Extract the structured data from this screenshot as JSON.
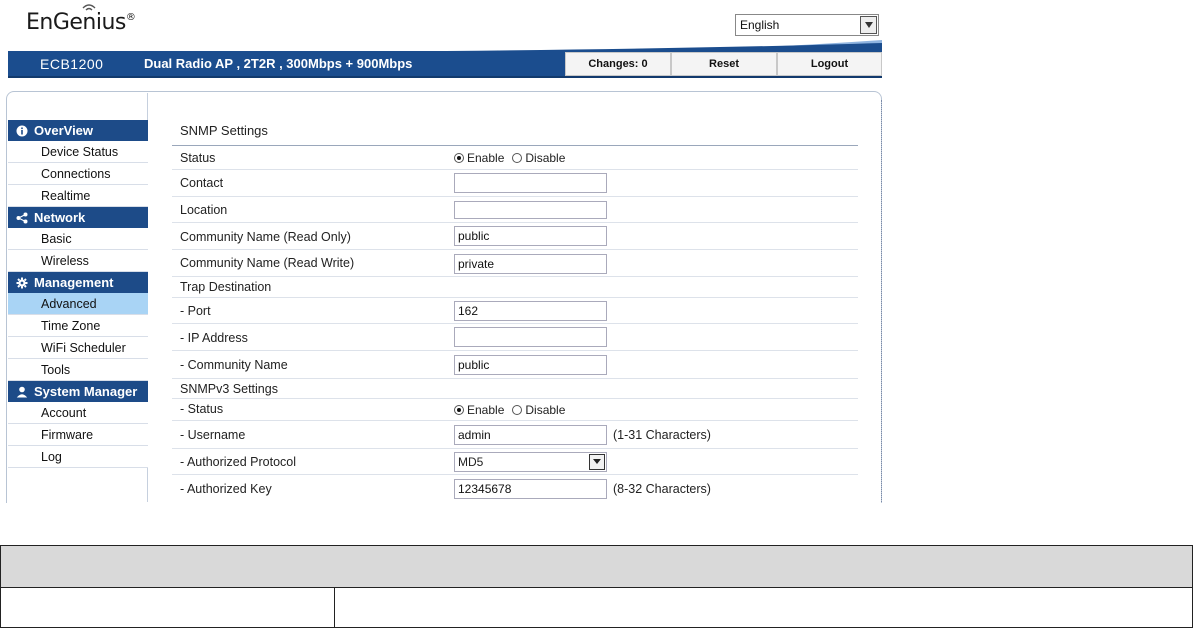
{
  "brand": {
    "name": "EnGenius",
    "reg": "®"
  },
  "language": {
    "selected": "English"
  },
  "header": {
    "model": "ECB1200",
    "description": "Dual Radio AP , 2T2R , 300Mbps + 900Mbps",
    "changes_label": "Changes: 0",
    "reset_label": "Reset",
    "logout_label": "Logout"
  },
  "sidebar": {
    "overview": {
      "title": "OverView",
      "items": [
        "Device Status",
        "Connections",
        "Realtime"
      ]
    },
    "network": {
      "title": "Network",
      "items": [
        "Basic",
        "Wireless"
      ]
    },
    "management": {
      "title": "Management",
      "items": [
        "Advanced",
        "Time Zone",
        "WiFi Scheduler",
        "Tools"
      ],
      "active": "Advanced"
    },
    "system": {
      "title": "System Manager",
      "items": [
        "Account",
        "Firmware",
        "Log"
      ]
    }
  },
  "form": {
    "title": "SNMP Settings",
    "status_label": "Status",
    "enable_label": "Enable",
    "disable_label": "Disable",
    "contact_label": "Contact",
    "contact_value": "",
    "location_label": "Location",
    "location_value": "",
    "community_ro_label": "Community Name (Read Only)",
    "community_ro_value": "public",
    "community_rw_label": "Community Name (Read Write)",
    "community_rw_value": "private",
    "trap_label": "Trap Destination",
    "port_label": "- Port",
    "port_value": "162",
    "ip_label": "- IP Address",
    "ip_value": "",
    "trap_community_label": "- Community Name",
    "trap_community_value": "public",
    "snmpv3_label": "SNMPv3 Settings",
    "v3_status_label": "- Status",
    "username_label": "- Username",
    "username_value": "admin",
    "username_hint": "(1-31 Characters)",
    "auth_protocol_label": "- Authorized Protocol",
    "auth_protocol_value": "MD5",
    "auth_key_label": "- Authorized Key",
    "auth_key_value": "12345678",
    "auth_key_hint": "(8-32 Characters)"
  },
  "colors": {
    "brand_blue": "#1b4d8e",
    "active_item": "#a9d4f5"
  }
}
